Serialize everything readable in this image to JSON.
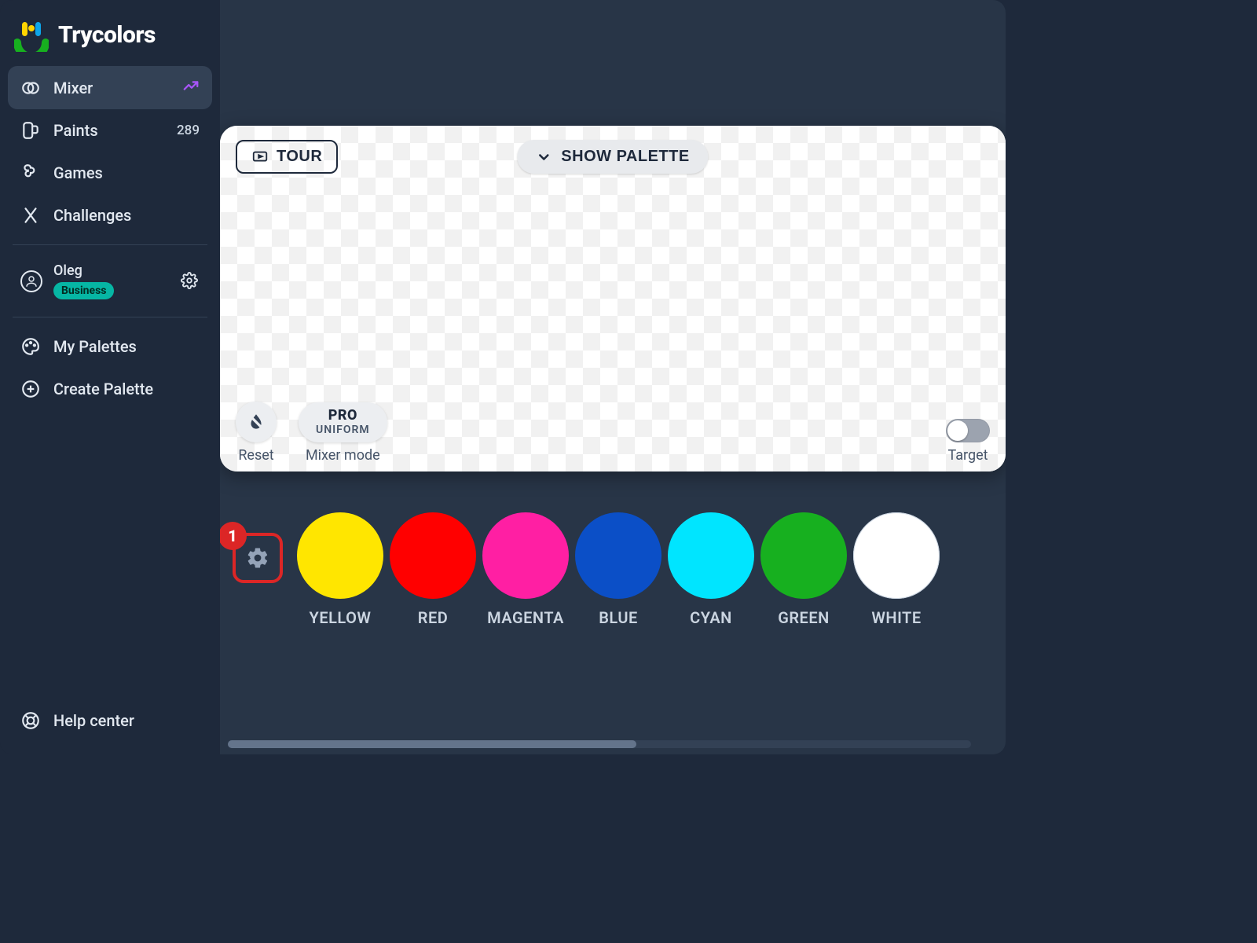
{
  "brand": {
    "name": "Trycolors"
  },
  "sidebar": {
    "items": [
      {
        "label": "Mixer",
        "badge": ""
      },
      {
        "label": "Paints",
        "badge": "289"
      },
      {
        "label": "Games",
        "badge": ""
      },
      {
        "label": "Challenges",
        "badge": ""
      }
    ],
    "user": {
      "name": "Oleg",
      "plan": "Business"
    },
    "secondary": [
      {
        "label": "My Palettes"
      },
      {
        "label": "Create Palette"
      }
    ],
    "help": {
      "label": "Help center"
    }
  },
  "canvas": {
    "tour_label": "TOUR",
    "show_palette_label": "SHOW PALETTE",
    "reset_label": "Reset",
    "mixer_mode": {
      "pro": "PRO",
      "sub": "UNIFORM",
      "caption": "Mixer mode"
    },
    "target_label": "Target",
    "target_on": false
  },
  "swatch_settings": {
    "badge": "1"
  },
  "swatches": [
    {
      "name": "YELLOW",
      "color": "#ffe600"
    },
    {
      "name": "RED",
      "color": "#ff0000"
    },
    {
      "name": "MAGENTA",
      "color": "#ff1fa3"
    },
    {
      "name": "BLUE",
      "color": "#0b4fc7"
    },
    {
      "name": "CYAN",
      "color": "#00e5ff"
    },
    {
      "name": "GREEN",
      "color": "#17b01f"
    },
    {
      "name": "WHITE",
      "color": "#ffffff"
    }
  ]
}
